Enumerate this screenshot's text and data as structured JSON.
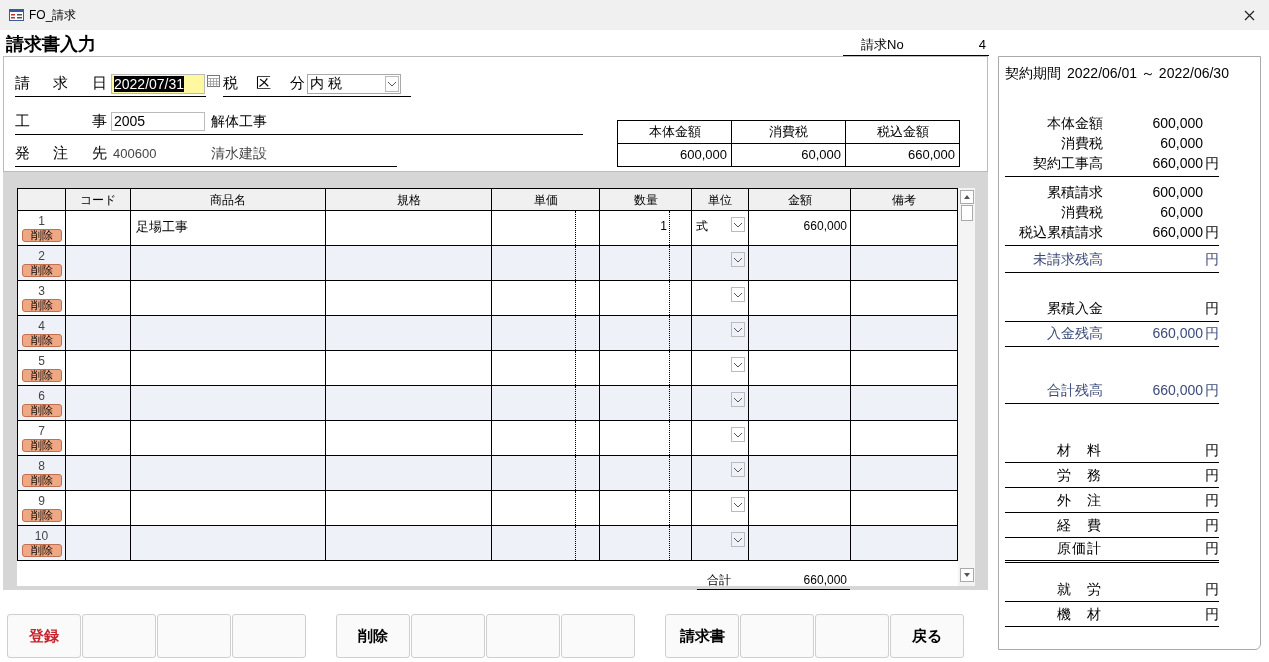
{
  "window": {
    "title": "FO_請求"
  },
  "form_title": "請求書入力",
  "invoice_no": {
    "label": "請求No",
    "value": "4"
  },
  "fields": {
    "date": {
      "label": "請 求 日",
      "value": "2022/07/31"
    },
    "tax": {
      "label": "税 区 分",
      "value": "内 税"
    },
    "project": {
      "label": "工 事",
      "code": "2005",
      "name": "解体工事"
    },
    "client": {
      "label": "発 注 先",
      "code": "400600",
      "name": "清水建設"
    }
  },
  "summary_table": {
    "columns": [
      "本体金額",
      "消費税",
      "税込金額"
    ],
    "values": [
      "600,000",
      "60,000",
      "660,000"
    ]
  },
  "grid": {
    "columns": [
      "コード",
      "商品名",
      "規格",
      "単価",
      "数量",
      "単位",
      "金額",
      "備考"
    ],
    "rows": [
      {
        "no": "1",
        "delete": "削除",
        "name": "足場工事",
        "qty": "1",
        "unit": "式",
        "amount": "660,000"
      },
      {
        "no": "2",
        "delete": "削除"
      },
      {
        "no": "3",
        "delete": "削除"
      },
      {
        "no": "4",
        "delete": "削除"
      },
      {
        "no": "5",
        "delete": "削除"
      },
      {
        "no": "6",
        "delete": "削除"
      },
      {
        "no": "7",
        "delete": "削除"
      },
      {
        "no": "8",
        "delete": "削除"
      },
      {
        "no": "9",
        "delete": "削除"
      },
      {
        "no": "10",
        "delete": "削除"
      }
    ],
    "total": {
      "label": "合計",
      "value": "660,000"
    }
  },
  "side_panel": {
    "period": {
      "label": "契約期間",
      "value": "2022/06/01 ～ 2022/06/30"
    },
    "groups": [
      {
        "rows": [
          {
            "kind": "amount",
            "label": "本体金額",
            "value": "600,000"
          },
          {
            "kind": "amount",
            "label": "消費税",
            "value": "60,000"
          },
          {
            "kind": "amount",
            "label": "契約工事高",
            "value": "660,000",
            "unit": "円"
          }
        ]
      },
      {
        "rows": [
          {
            "kind": "amount",
            "label": "累積請求",
            "value": "600,000"
          },
          {
            "kind": "amount",
            "label": "消費税",
            "value": "60,000"
          },
          {
            "kind": "amount",
            "label": "税込累積請求",
            "value": "660,000",
            "unit": "円"
          }
        ]
      },
      {
        "rows": [
          {
            "kind": "balance",
            "label": "未請求残高",
            "unit": "円"
          }
        ]
      },
      {
        "rows": [
          {
            "kind": "amount",
            "label": "累積入金",
            "unit": "円"
          }
        ]
      },
      {
        "rows": [
          {
            "kind": "balance",
            "label": "入金残高",
            "value": "660,000",
            "unit": "円"
          }
        ]
      },
      {
        "rows": [
          {
            "kind": "balance",
            "label": "合計残高",
            "value": "660,000",
            "unit": "円"
          }
        ]
      },
      {
        "rows": [
          {
            "kind": "cost",
            "label": "材 料",
            "unit": "円"
          },
          {
            "kind": "cost",
            "label": "労 務",
            "unit": "円"
          },
          {
            "kind": "cost",
            "label": "外 注",
            "unit": "円"
          },
          {
            "kind": "cost",
            "label": "経 費",
            "unit": "円"
          },
          {
            "kind": "cost_total",
            "label": "原価計",
            "unit": "円"
          }
        ]
      },
      {
        "rows": [
          {
            "kind": "cost",
            "label": "就 労",
            "unit": "円"
          },
          {
            "kind": "cost",
            "label": "機 材",
            "unit": "円"
          }
        ]
      }
    ]
  },
  "button_groups": [
    {
      "start": [
        {
          "label": "登録",
          "danger": true
        }
      ]
    },
    {
      "start": [
        {
          "label": "削除",
          "danger": false
        }
      ]
    },
    {
      "start": [
        {
          "label": "請求書",
          "danger": false
        }
      ],
      "end": [
        {
          "label": "戻る",
          "danger": false
        }
      ]
    }
  ]
}
